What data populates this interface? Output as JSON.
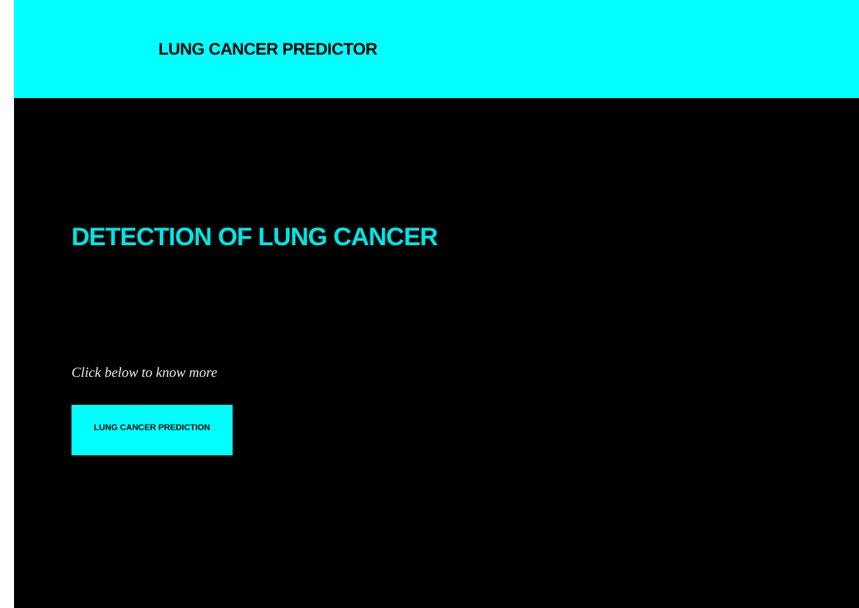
{
  "header": {
    "title": "LUNG CANCER PREDICTOR"
  },
  "hero": {
    "heading": "DETECTION OF LUNG CANCER",
    "prompt": "Click below to know more",
    "button": "LUNG CANCER PREDICTION"
  }
}
